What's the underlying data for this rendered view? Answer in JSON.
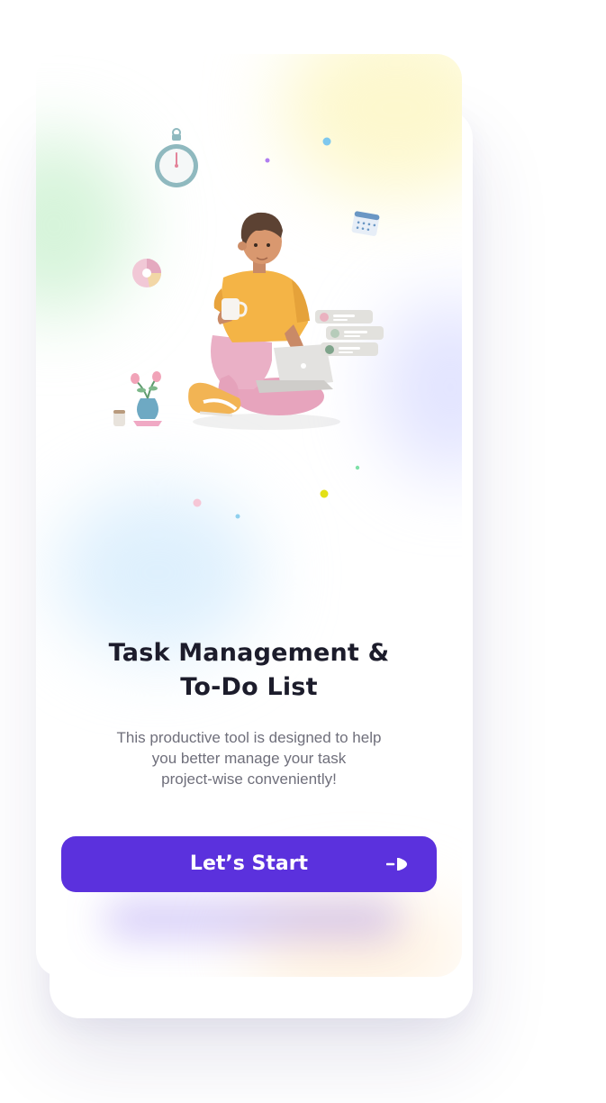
{
  "onboarding": {
    "illustration_icon": "person-working-on-laptop-illustration",
    "title_lines": [
      "Task Management &",
      "To-Do List"
    ],
    "description_lines": [
      "This productive tool is designed to help",
      "you better manage your task",
      "project-wise conveniently!"
    ],
    "start_button": {
      "label": "Let’s Start",
      "icon": "arrow-right-icon"
    }
  },
  "colors": {
    "accent": "#5B31DD",
    "title": "#1C1C2B",
    "body_text": "#6F6F7B",
    "background": "#FFFFFF"
  }
}
